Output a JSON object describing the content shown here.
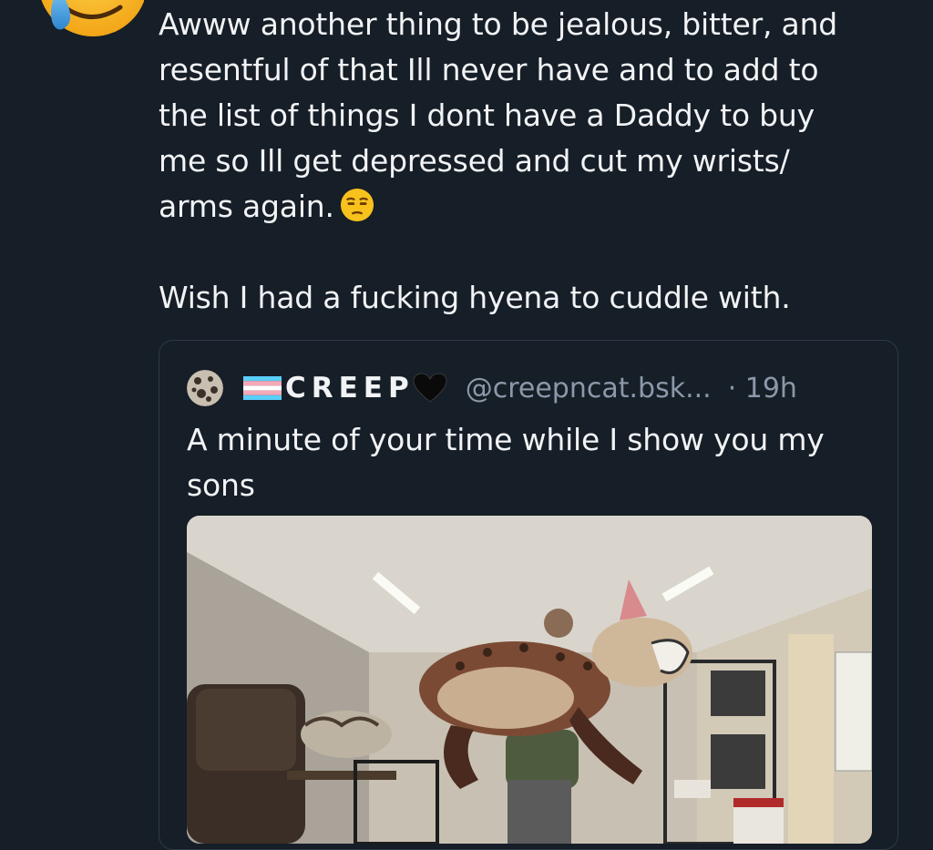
{
  "post": {
    "text": "Awww another thing to be jealous, bitter, and\nresentful of that Ill never have and to add to\nthe list of things I dont have a Daddy to buy\nme so Ill get depressed and cut my wrists/\narms again.",
    "text_2": "Wish I had a fucking hyena to cuddle with.",
    "avatar_icon": "crying-emoji-icon",
    "inline_icon": "unamused-face-emoji-icon"
  },
  "quote": {
    "display_name": "CREEP",
    "name_prefix_icon": "transgender-flag-icon",
    "name_suffix_icon": "black-heart-icon",
    "handle": "@creepncat.bsk...",
    "time": "· 19h",
    "text": "A minute of your time while I show you my sons",
    "media_description_icon": "video-thumbnail"
  },
  "colors": {
    "background": "#161e27",
    "text": "#f1f3f5",
    "muted": "#8b98a9",
    "border": "#2e3a47"
  }
}
